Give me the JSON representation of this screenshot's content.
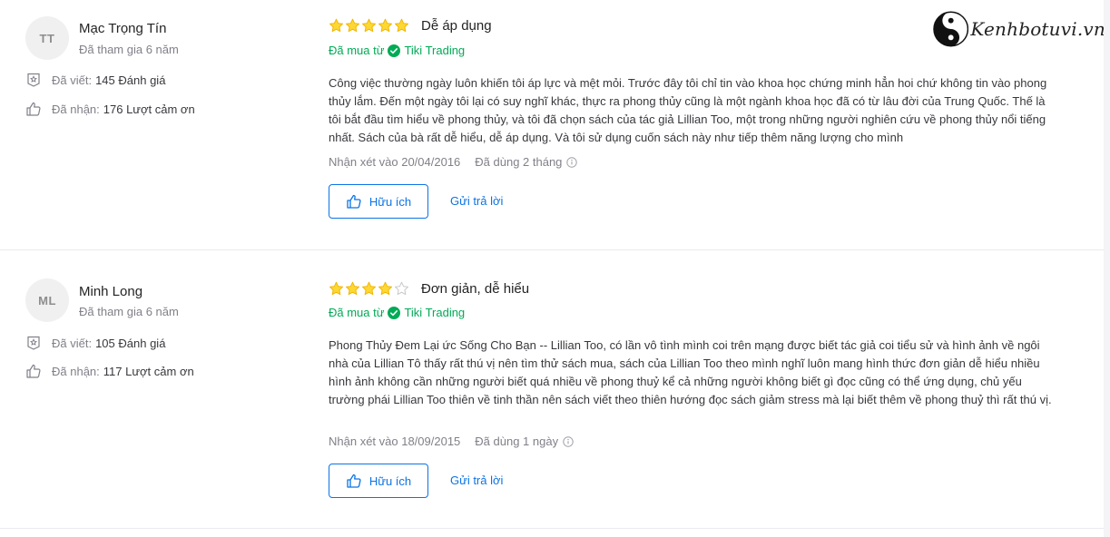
{
  "logo": {
    "text": "Kenhbotuvi.vn"
  },
  "labels": {
    "bought_from": "Đã mua từ",
    "written": "Đã viết:",
    "received": "Đã nhận:",
    "helpful": "Hữu ích",
    "reply": "Gửi trả lời"
  },
  "colors": {
    "accent": "#0b74e5",
    "green": "#00ab56",
    "star": "#fdd835"
  },
  "reviews": [
    {
      "initials": "TT",
      "name": "Mạc Trọng Tín",
      "joined": "Đã tham gia 6 năm",
      "written_count": "145 Đánh giá",
      "received_count": "176 Lượt cảm ơn",
      "rating": 5,
      "title": "Dễ áp dụng",
      "seller": "Tiki Trading",
      "body": "Công việc thường ngày luôn khiến tôi áp lực và mệt mỏi. Trước đây tôi chỉ tin vào khoa học chứng minh hẳn hoi chứ không tin vào phong thủy lắm. Đến một ngày tôi lại có suy nghĩ khác, thực ra phong thủy cũng là một ngành khoa học đã có từ lâu đời của Trung Quốc. Thế là tôi bắt đầu tìm hiểu về phong thủy, và tôi đã chọn sách của tác giả Lillian Too, một trong những người nghiên cứu về phong thủy nổi tiếng nhất. Sách của bà rất dễ hiểu, dễ áp dụng. Và tôi sử dụng cuốn sách này như tiếp thêm năng lượng cho mình",
      "date": "Nhận xét vào 20/04/2016",
      "used": "Đã dùng 2 tháng"
    },
    {
      "initials": "ML",
      "name": "Minh Long",
      "joined": "Đã tham gia 6 năm",
      "written_count": "105 Đánh giá",
      "received_count": "117 Lượt cảm ơn",
      "rating": 4,
      "title": "Đơn giản, dễ hiểu",
      "seller": "Tiki Trading",
      "body": "Phong Thủy Đem Lại ức Sống Cho Bạn -- Lillian Too, có lần vô tình mình coi trên mạng được biết tác giả coi tiểu sử và hình ảnh về ngôi nhà của Lillian Tô thấy rất thú vị nên tìm thử sách mua, sách của Lillian Too theo mình nghĩ luôn mang hình thức đơn giản dễ hiểu nhiều hình ảnh không cần những người biết quá nhiều về phong thuỷ kể cả những người không biết gì đọc cũng có thể ứng dụng, chủ yếu trường phái Lillian Too thiên về tinh thần nên sách viết theo thiên hướng đọc sách giảm stress mà lại biết thêm về phong thuỷ thì rất thú vị.",
      "date": "Nhận xét vào 18/09/2015",
      "used": "Đã dùng 1 ngày"
    }
  ]
}
